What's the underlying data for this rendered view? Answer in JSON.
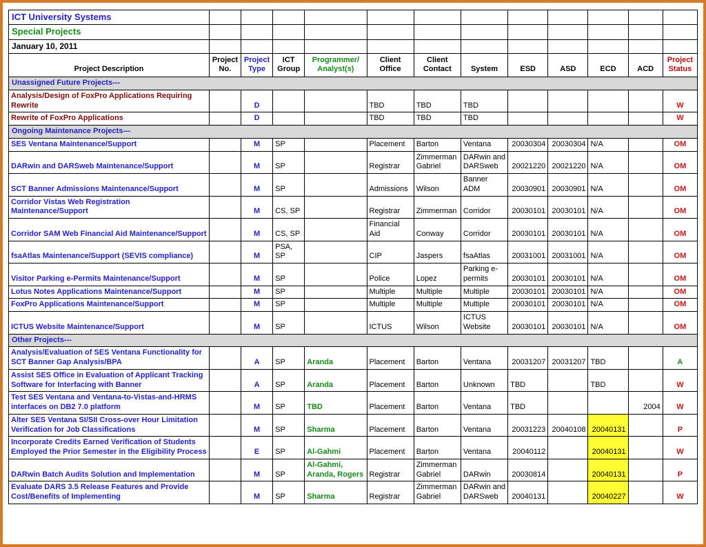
{
  "title": "ICT University Systems",
  "subtitle": "Special Projects",
  "date": "January 10, 2011",
  "headers": {
    "desc": "Project Description",
    "no": "Project No.",
    "ptype": "Project Type",
    "group": "ICT Group",
    "prog": "Programmer/ Analyst(s)",
    "office": "Client Office",
    "contact": "Client Contact",
    "system": "System",
    "esd": "ESD",
    "asd": "ASD",
    "ecd": "ECD",
    "acd": "ACD",
    "status": "Project Status"
  },
  "sections": {
    "s1": "Unassigned Future Projects---",
    "s2": "Ongoing Maintenance Projects---",
    "s3": "Other Projects---"
  },
  "chart_data": {
    "type": "table",
    "rows": [
      {
        "section": "Unassigned Future Projects---",
        "desc": "Analysis/Design of FoxPro Applications Requiring Rewrite",
        "no": "",
        "ptype": "D",
        "group": "",
        "prog": "",
        "office": "TBD",
        "contact": "TBD",
        "system": "TBD",
        "esd": "",
        "asd": "",
        "ecd": "",
        "acd": "",
        "status": "W",
        "desc_color": "maroon",
        "status_color": "red",
        "ecd_hl": false
      },
      {
        "section": "Unassigned Future Projects---",
        "desc": "Rewrite of FoxPro Applications",
        "no": "",
        "ptype": "D",
        "group": "",
        "prog": "",
        "office": "TBD",
        "contact": "TBD",
        "system": "TBD",
        "esd": "",
        "asd": "",
        "ecd": "",
        "acd": "",
        "status": "W",
        "desc_color": "maroon",
        "status_color": "red",
        "ecd_hl": false
      },
      {
        "section": "Ongoing Maintenance Projects---",
        "desc": "SES Ventana Maintenance/Support",
        "no": "",
        "ptype": "M",
        "group": "SP",
        "prog": "",
        "office": "Placement",
        "contact": "Barton",
        "system": "Ventana",
        "esd": "20030304",
        "asd": "20030304",
        "ecd": "N/A",
        "acd": "",
        "status": "OM",
        "desc_color": "blue",
        "status_color": "red",
        "ecd_hl": false
      },
      {
        "section": "Ongoing Maintenance Projects---",
        "desc": "DARwin and DARSweb Maintenance/Support",
        "no": "",
        "ptype": "M",
        "group": "SP",
        "prog": "",
        "office": "Registrar",
        "contact": "Zimmerman Gabriel",
        "system": "DARwin and DARSweb",
        "esd": "20021220",
        "asd": "20021220",
        "ecd": "N/A",
        "acd": "",
        "status": "OM",
        "desc_color": "blue",
        "status_color": "red",
        "ecd_hl": false
      },
      {
        "section": "Ongoing Maintenance Projects---",
        "desc": "SCT Banner Admissions Maintenance/Support",
        "no": "",
        "ptype": "M",
        "group": "SP",
        "prog": "",
        "office": "Admissions",
        "contact": "Wilson",
        "system": "Banner ADM",
        "esd": "20030901",
        "asd": "20030901",
        "ecd": "N/A",
        "acd": "",
        "status": "OM",
        "desc_color": "blue",
        "status_color": "red",
        "ecd_hl": false
      },
      {
        "section": "Ongoing Maintenance Projects---",
        "desc": "Corridor Vistas Web Registration Maintenance/Support",
        "no": "",
        "ptype": "M",
        "group": "CS, SP",
        "prog": "",
        "office": "Registrar",
        "contact": "Zimmerman",
        "system": "Corridor",
        "esd": "20030101",
        "asd": "20030101",
        "ecd": "N/A",
        "acd": "",
        "status": "OM",
        "desc_color": "blue",
        "status_color": "red",
        "ecd_hl": false
      },
      {
        "section": "Ongoing Maintenance Projects---",
        "desc": "Corridor SAM Web Financial Aid Maintenance/Support",
        "no": "",
        "ptype": "M",
        "group": "CS, SP",
        "prog": "",
        "office": "Financial Aid",
        "contact": "Conway",
        "system": "Corridor",
        "esd": "20030101",
        "asd": "20030101",
        "ecd": "N/A",
        "acd": "",
        "status": "OM",
        "desc_color": "blue",
        "status_color": "red",
        "ecd_hl": false
      },
      {
        "section": "Ongoing Maintenance Projects---",
        "desc": "fsaAtlas Maintenance/Support (SEVIS compliance)",
        "no": "",
        "ptype": "M",
        "group": "PSA, SP",
        "prog": "",
        "office": "CIP",
        "contact": "Jaspers",
        "system": "fsaAtlas",
        "esd": "20031001",
        "asd": "20031001",
        "ecd": "N/A",
        "acd": "",
        "status": "OM",
        "desc_color": "blue",
        "status_color": "red",
        "ecd_hl": false
      },
      {
        "section": "Ongoing Maintenance Projects---",
        "desc": "Visitor Parking e-Permits Maintenance/Support",
        "no": "",
        "ptype": "M",
        "group": "SP",
        "prog": "",
        "office": "Police",
        "contact": "Lopez",
        "system": "Parking e-permits",
        "esd": "20030101",
        "asd": "20030101",
        "ecd": "N/A",
        "acd": "",
        "status": "OM",
        "desc_color": "blue",
        "status_color": "red",
        "ecd_hl": false
      },
      {
        "section": "Ongoing Maintenance Projects---",
        "desc": "Lotus Notes Applications Maintenance/Support",
        "no": "",
        "ptype": "M",
        "group": "SP",
        "prog": "",
        "office": "Multiple",
        "contact": "Multiple",
        "system": "Multiple",
        "esd": "20030101",
        "asd": "20030101",
        "ecd": "N/A",
        "acd": "",
        "status": "OM",
        "desc_color": "blue",
        "status_color": "red",
        "ecd_hl": false
      },
      {
        "section": "Ongoing Maintenance Projects---",
        "desc": "FoxPro Applications Maintenance/Support",
        "no": "",
        "ptype": "M",
        "group": "SP",
        "prog": "",
        "office": "Multiple",
        "contact": "Multiple",
        "system": "Multiple",
        "esd": "20030101",
        "asd": "20030101",
        "ecd": "N/A",
        "acd": "",
        "status": "OM",
        "desc_color": "blue",
        "status_color": "red",
        "ecd_hl": false
      },
      {
        "section": "Ongoing Maintenance Projects---",
        "desc": "ICTUS Website Maintenance/Support",
        "no": "",
        "ptype": "M",
        "group": "SP",
        "prog": "",
        "office": "ICTUS",
        "contact": "Wilson",
        "system": "ICTUS Website",
        "esd": "20030101",
        "asd": "20030101",
        "ecd": "N/A",
        "acd": "",
        "status": "OM",
        "desc_color": "blue",
        "status_color": "red",
        "ecd_hl": false
      },
      {
        "section": "Other Projects---",
        "desc": "Analysis/Evaluation of SES Ventana Functionality for SCT Banner Gap Analysis/BPA",
        "no": "",
        "ptype": "A",
        "group": "SP",
        "prog": "Aranda",
        "office": "Placement",
        "contact": "Barton",
        "system": "Ventana",
        "esd": "20031207",
        "asd": "20031207",
        "ecd": "TBD",
        "acd": "",
        "status": "A",
        "desc_color": "blue",
        "status_color": "green",
        "ecd_hl": false
      },
      {
        "section": "Other Projects---",
        "desc": "Assist SES Office in Evaluation of Applicant Tracking Software for Interfacing with Banner",
        "no": "",
        "ptype": "A",
        "group": "SP",
        "prog": "Aranda",
        "office": "Placement",
        "contact": "Barton",
        "system": "Unknown",
        "esd": "TBD",
        "asd": "",
        "ecd": "TBD",
        "acd": "",
        "status": "W",
        "desc_color": "blue",
        "status_color": "red",
        "ecd_hl": false
      },
      {
        "section": "Other Projects---",
        "desc": "Test SES Ventana and Ventana-to-Vistas-and-HRMS interfaces on DB2 7.0 platform",
        "no": "",
        "ptype": "M",
        "group": "SP",
        "prog": "TBD",
        "office": "Placement",
        "contact": "Barton",
        "system": "Ventana",
        "esd": "TBD",
        "asd": "",
        "ecd": "",
        "acd": "2004",
        "status": "W",
        "desc_color": "blue",
        "status_color": "red",
        "ecd_hl": false
      },
      {
        "section": "Other Projects---",
        "desc": "Alter SES Ventana SI/SII Cross-over Hour Limitation Verification for Job Classifications",
        "no": "",
        "ptype": "M",
        "group": "SP",
        "prog": "Sharma",
        "office": "Placement",
        "contact": "Barton",
        "system": "Ventana",
        "esd": "20031223",
        "asd": "20040108",
        "ecd": "20040131",
        "acd": "",
        "status": "P",
        "desc_color": "blue",
        "status_color": "red",
        "ecd_hl": true
      },
      {
        "section": "Other Projects---",
        "desc": "Incorporate Credits Earned Verification of Students Employed the Prior Semester in the Eligibility Process",
        "no": "",
        "ptype": "E",
        "group": "SP",
        "prog": "Al-Gahmi",
        "office": "Placement",
        "contact": "Barton",
        "system": "Ventana",
        "esd": "20040112",
        "asd": "",
        "ecd": "20040131",
        "acd": "",
        "status": "W",
        "desc_color": "blue",
        "status_color": "red",
        "ecd_hl": true
      },
      {
        "section": "Other Projects---",
        "desc": "DARwin Batch Audits Solution and Implementation",
        "no": "",
        "ptype": "M",
        "group": "SP",
        "prog": "Al-Gahmi, Aranda, Rogers",
        "office": "Registrar",
        "contact": "Zimmerman Gabriel",
        "system": "DARwin",
        "esd": "20030814",
        "asd": "",
        "ecd": "20040131",
        "acd": "",
        "status": "P",
        "desc_color": "blue",
        "status_color": "red",
        "ecd_hl": true
      },
      {
        "section": "Other Projects---",
        "desc": "Evaluate DARS 3.5 Release Features and Provide Cost/Benefits of Implementing",
        "no": "",
        "ptype": "M",
        "group": "SP",
        "prog": "Sharma",
        "office": "Registrar",
        "contact": "Zimmerman Gabriel",
        "system": "DARwin and DARSweb",
        "esd": "20040131",
        "asd": "",
        "ecd": "20040227",
        "acd": "",
        "status": "W",
        "desc_color": "blue",
        "status_color": "red",
        "ecd_hl": true
      }
    ]
  }
}
